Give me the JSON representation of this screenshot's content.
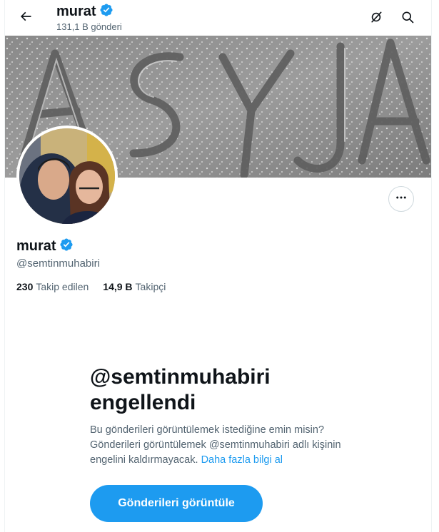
{
  "header": {
    "name": "murat",
    "post_count": "131,1 B gönderi",
    "icons": [
      "back-arrow-icon",
      "grok-slash-icon",
      "search-icon"
    ]
  },
  "banner": {
    "written_text": "ASYA"
  },
  "profile": {
    "name": "murat",
    "handle": "@semtinmuhabiri",
    "verified": true,
    "following_count": "230",
    "following_label": "Takip edilen",
    "followers_count": "14,9 B",
    "followers_label": "Takipçi"
  },
  "blocked": {
    "title_line1": "@semtinmuhabiri",
    "title_line2": "engellendi",
    "description": "Bu gönderileri görüntülemek istediğine emin misin? Gönderileri görüntülemek @semtinmuhabiri adlı kişinin engelini kaldırmayacak.",
    "link_text": "Daha fazla bilgi al",
    "button_label": "Gönderileri görüntüle"
  },
  "colors": {
    "accent": "#1d9bf0",
    "text_primary": "#0f1419",
    "text_secondary": "#536471"
  }
}
